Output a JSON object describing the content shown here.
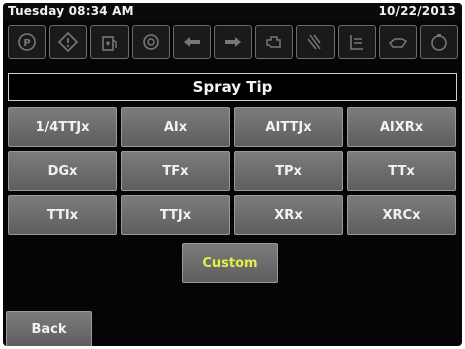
{
  "status": {
    "day_time": "Tuesday 08:34 AM",
    "date": "10/22/2013"
  },
  "icons": [
    "parking-brake-icon",
    "warning-icon",
    "fuel-icon",
    "transmission-icon",
    "left-turn-icon",
    "right-turn-icon",
    "engine-icon",
    "spray-fan-icon",
    "hydraulic-icon",
    "engine-oil-icon",
    "tank-level-icon"
  ],
  "title": "Spray Tip",
  "tips": [
    "1/4TTJx",
    "AIx",
    "AITTJx",
    "AIXRx",
    "DGx",
    "TFx",
    "TPx",
    "TTx",
    "TTIx",
    "TTJx",
    "XRx",
    "XRCx"
  ],
  "custom_label": "Custom",
  "back_label": "Back",
  "colors": {
    "background": "#050505",
    "button": "#6e6e6e",
    "custom_text": "#e3f04a",
    "text": "#f2f2f2"
  }
}
